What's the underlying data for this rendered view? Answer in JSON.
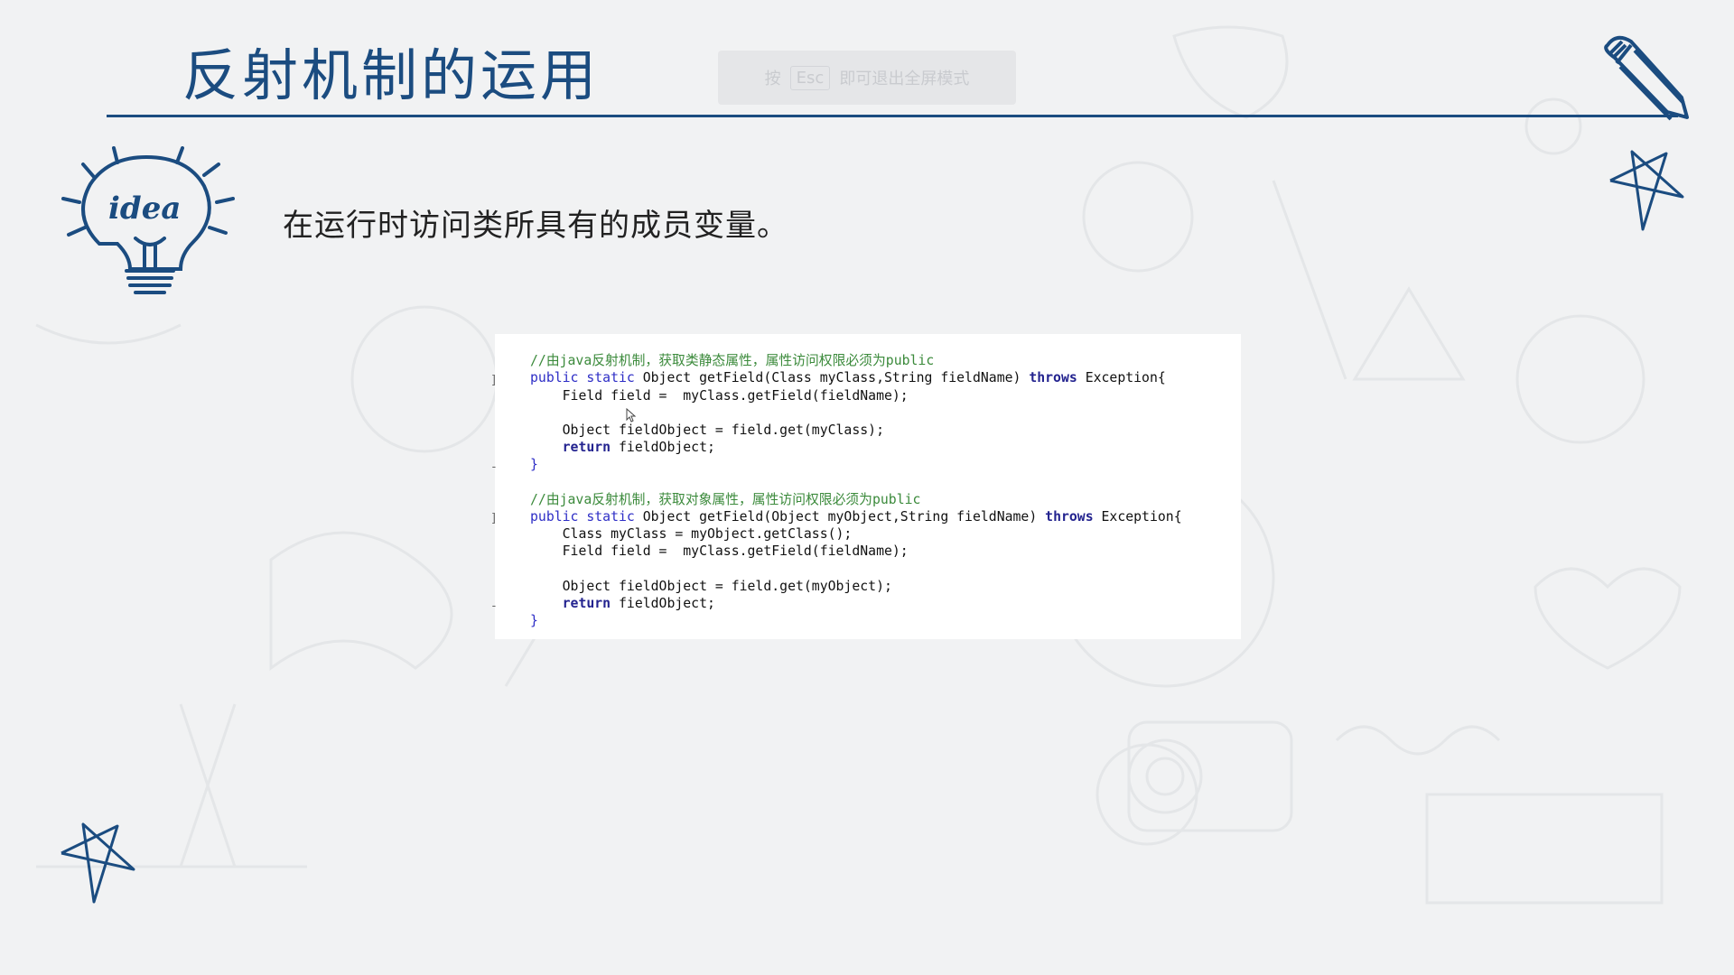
{
  "slide": {
    "title": "反射机制的运用",
    "bullet": "在运行时访问类所具有的成员变量。",
    "overlay_hint": {
      "key_text": "Esc",
      "prefix": "按",
      "suffix": "即可退出全屏模式"
    }
  },
  "code": {
    "lines": [
      {
        "kind": "blank"
      },
      {
        "kind": "comment",
        "text": "//由java反射机制，获取类静态属性，属性访问权限必须为public"
      },
      {
        "kind": "code",
        "parts": [
          [
            "kw",
            "public static "
          ],
          [
            "",
            "Object getField(Class myClass,String fieldName) "
          ],
          [
            "kwb",
            "throws"
          ],
          [
            "",
            " Exception{"
          ]
        ]
      },
      {
        "kind": "code",
        "parts": [
          [
            "",
            "    Field field =  myClass.getField(fieldName);"
          ]
        ]
      },
      {
        "kind": "blank"
      },
      {
        "kind": "code",
        "parts": [
          [
            "",
            "    Object fieldObject = field.get(myClass);"
          ]
        ]
      },
      {
        "kind": "code",
        "parts": [
          [
            "kwb",
            "    return"
          ],
          [
            "",
            " fieldObject;"
          ]
        ]
      },
      {
        "kind": "code",
        "parts": [
          [
            "kw",
            "}"
          ]
        ]
      },
      {
        "kind": "blank"
      },
      {
        "kind": "comment",
        "text": "//由java反射机制，获取对象属性，属性访问权限必须为public"
      },
      {
        "kind": "code",
        "parts": [
          [
            "kw",
            "public static "
          ],
          [
            "",
            "Object getField(Object myObject,String fieldName) "
          ],
          [
            "kwb",
            "throws"
          ],
          [
            "",
            " Exception{"
          ]
        ]
      },
      {
        "kind": "code",
        "parts": [
          [
            "",
            "    Class myClass = myObject.getClass();"
          ]
        ]
      },
      {
        "kind": "code",
        "parts": [
          [
            "",
            "    Field field =  myClass.getField(fieldName);"
          ]
        ]
      },
      {
        "kind": "blank"
      },
      {
        "kind": "code",
        "parts": [
          [
            "",
            "    Object fieldObject = field.get(myObject);"
          ]
        ]
      },
      {
        "kind": "code",
        "parts": [
          [
            "kwb",
            "    return"
          ],
          [
            "",
            " fieldObject;"
          ]
        ]
      },
      {
        "kind": "code",
        "parts": [
          [
            "kw",
            "}"
          ]
        ]
      }
    ],
    "gutter_marks": [
      "]",
      "-",
      "]",
      "-"
    ]
  },
  "colors": {
    "accent": "#1b4c80",
    "comment": "#3b8a3b",
    "keyword": "#2d2dc6",
    "background": "#f1f2f3"
  },
  "icons": [
    "idea-bulb-icon",
    "pencil-icon",
    "star-icon",
    "pen-tool-icon",
    "screen-icon",
    "eraser-icon",
    "pointer-icon"
  ]
}
